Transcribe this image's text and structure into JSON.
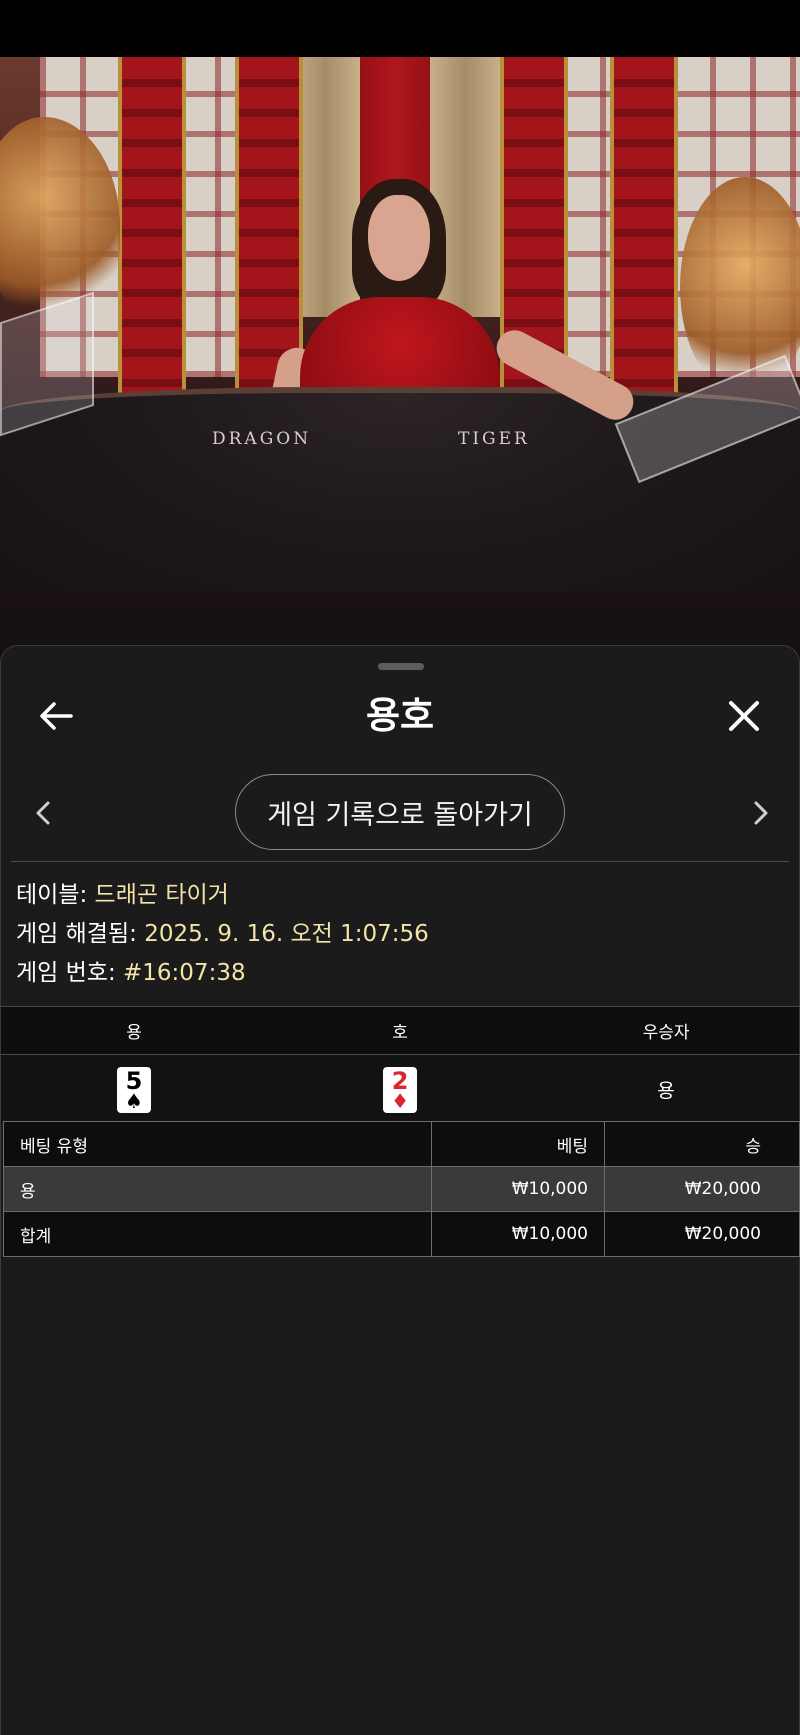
{
  "video": {
    "table_labels": {
      "dragon": "DRAGON",
      "tiger": "TIGER"
    }
  },
  "sheet": {
    "title": "용호",
    "back_icon": "arrow-left-icon",
    "close_icon": "close-icon",
    "return_button": "게임 기록으로 돌아가기",
    "prev_icon": "chevron-left-icon",
    "next_icon": "chevron-right-icon"
  },
  "info": {
    "table_label": "테이블:",
    "table_value": "드래곤 타이거",
    "resolved_label": "게임 해결됨:",
    "resolved_value": "2025. 9. 16. 오전 1:07:56",
    "number_label": "게임 번호:",
    "number_value": "#16:07:38"
  },
  "round": {
    "headers": [
      "용",
      "호",
      "우승자"
    ],
    "dragon_card": {
      "rank": "5",
      "suit": "♠",
      "color": "black"
    },
    "tiger_card": {
      "rank": "2",
      "suit": "♦",
      "color": "red"
    },
    "winner": "용"
  },
  "bets": {
    "headers": [
      "베팅 유형",
      "베팅",
      "승"
    ],
    "rows": [
      {
        "type": "용",
        "bet": "₩10,000",
        "win": "₩20,000"
      },
      {
        "type": "합계",
        "bet": "₩10,000",
        "win": "₩20,000"
      }
    ]
  },
  "colors": {
    "accent_value": "#f3e3a8",
    "sheet_bg": "#1b1b1b"
  }
}
